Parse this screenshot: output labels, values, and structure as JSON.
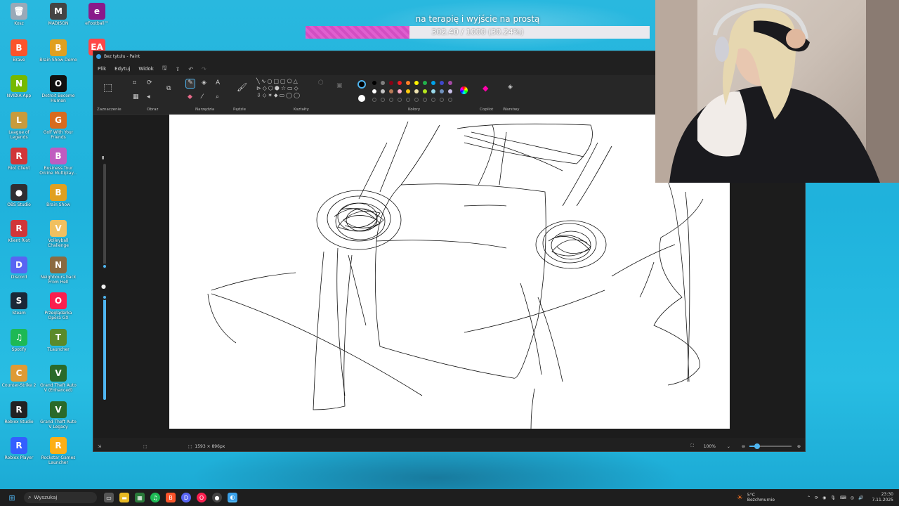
{
  "desktop_icons": [
    {
      "label": "Kosz",
      "color": "#9aa9b8",
      "glyph": "🗑"
    },
    {
      "label": "Brave",
      "color": "#fb542b",
      "glyph": "B"
    },
    {
      "label": "NVIDIA App",
      "color": "#76b900",
      "glyph": "N"
    },
    {
      "label": "League of Legends",
      "color": "#c89b3c",
      "glyph": "L"
    },
    {
      "label": "Riot Client",
      "color": "#d13639",
      "glyph": "R"
    },
    {
      "label": "OBS Studio",
      "color": "#302e31",
      "glyph": "●"
    },
    {
      "label": "Klient Riot",
      "color": "#d13639",
      "glyph": "R"
    },
    {
      "label": "Discord",
      "color": "#5865f2",
      "glyph": "D"
    },
    {
      "label": "Steam",
      "color": "#1b2838",
      "glyph": "S"
    },
    {
      "label": "Spotify",
      "color": "#1db954",
      "glyph": "♫"
    },
    {
      "label": "Counter-Strike 2",
      "color": "#de9b35",
      "glyph": "C"
    },
    {
      "label": "Roblox Studio",
      "color": "#222222",
      "glyph": "R"
    },
    {
      "label": "Roblox Player",
      "color": "#335fff",
      "glyph": "R"
    },
    {
      "label": "MADISON",
      "color": "#444444",
      "glyph": "M"
    },
    {
      "label": "Brain Show Demo",
      "color": "#e0a020",
      "glyph": "B"
    },
    {
      "label": "Detroit Become Human",
      "color": "#111111",
      "glyph": "O"
    },
    {
      "label": "Golf With Your Friends",
      "color": "#d86b1e",
      "glyph": "G"
    },
    {
      "label": "Business Tour Online Multiplay...",
      "color": "#c05cc0",
      "glyph": "B"
    },
    {
      "label": "Brain Show",
      "color": "#e0a020",
      "glyph": "B"
    },
    {
      "label": "Volleyball Challenge",
      "color": "#f0c060",
      "glyph": "V"
    },
    {
      "label": "Neighbours back From Hell",
      "color": "#8a6a40",
      "glyph": "N"
    },
    {
      "label": "Przeglądarka Opera GX",
      "color": "#fa1e4e",
      "glyph": "O"
    },
    {
      "label": "TLauncher",
      "color": "#5a8a2a",
      "glyph": "T"
    },
    {
      "label": "Grand Theft Auto V (Enhanced)",
      "color": "#2a6a2a",
      "glyph": "V"
    },
    {
      "label": "Grand Theft Auto V Legacy",
      "color": "#2a6a2a",
      "glyph": "V"
    },
    {
      "label": "Rockstar Games Launcher",
      "color": "#fcaf17",
      "glyph": "R"
    },
    {
      "label": "eFootball™",
      "color": "#8a1a8a",
      "glyph": "e"
    },
    {
      "label": "EA",
      "color": "#ff4747",
      "glyph": "EA"
    }
  ],
  "goal": {
    "title": "na terapię i wyjście na prostą",
    "progress_text": "302.40 / 1000 (30.24%)",
    "fraction": 0.3024,
    "fill_color": "#e05fcf"
  },
  "paint": {
    "window_title": "Bez tytułu - Paint",
    "menu": [
      "Plik",
      "Edytuj",
      "Widok"
    ],
    "groups": [
      "Zaznaczenie",
      "Obraz",
      "Narzędzia",
      "Pędzle",
      "Kształty",
      "Kolory",
      "Copilot",
      "Warstwy"
    ],
    "palette_row1": [
      "#000000",
      "#7f7f7f",
      "#880015",
      "#ed1c24",
      "#ff7f27",
      "#fff200",
      "#22b14c",
      "#00a2e8",
      "#3f48cc",
      "#a349a4"
    ],
    "palette_row2": [
      "#ffffff",
      "#c3c3c3",
      "#b97a57",
      "#ffaec9",
      "#ffc90e",
      "#efe4b0",
      "#b5e61d",
      "#99d9ea",
      "#7092be",
      "#c8bfe7"
    ],
    "status": {
      "canvas_size": "1593 × 896px",
      "zoom": "100%"
    }
  },
  "taskbar": {
    "search_placeholder": "Wyszukaj",
    "weather_temp": "5°C",
    "weather_desc": "Bezchmurnie",
    "time": "23:30",
    "date": "7.11.2025"
  }
}
